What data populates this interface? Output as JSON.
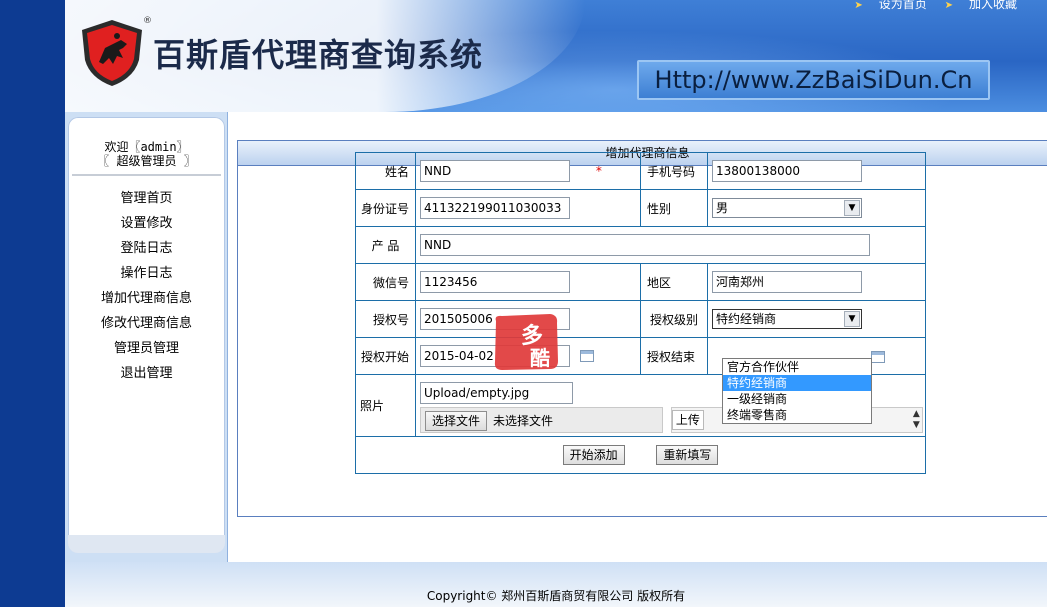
{
  "header": {
    "app_title": "百斯盾代理商查询系统",
    "reg_mark": "®",
    "url": "Http://www.ZzBaiSiDun.Cn",
    "links": [
      "设为首页",
      "加入收藏"
    ]
  },
  "sidebar": {
    "welcome_line1": "欢迎〖admin〗",
    "welcome_line2": "〖 超级管理员 〗",
    "items": [
      {
        "label": "管理首页"
      },
      {
        "label": "设置修改"
      },
      {
        "label": "登陆日志"
      },
      {
        "label": "操作日志"
      },
      {
        "label": "增加代理商信息"
      },
      {
        "label": "修改代理商信息"
      },
      {
        "label": "管理员管理"
      },
      {
        "label": "退出管理"
      }
    ]
  },
  "form": {
    "title": "增加代理商信息",
    "name_label": "姓名",
    "name_value": "NND",
    "required_mark": "*",
    "phone_label": "手机号码",
    "phone_value": "13800138000",
    "id_label": "身份证号",
    "id_value": "411322199011030033",
    "gender_label": "性别",
    "gender_value": "男",
    "product_label": "产 品",
    "product_value": "NND",
    "wechat_label": "微信号",
    "wechat_value": "1123456",
    "region_label": "地区",
    "region_value": "河南郑州",
    "auth_no_label": "授权号",
    "auth_no_value": "201505006",
    "auth_level_label": "授权级别",
    "auth_level_value": "特约经销商",
    "auth_level_options": [
      "官方合作伙伴",
      "特约经销商",
      "一级经销商",
      "终端零售商"
    ],
    "auth_level_highlighted": "特约经销商",
    "start_label": "授权开始",
    "start_value": "2015-04-02",
    "end_label": "授权结束",
    "photo_label": "照片",
    "photo_value": "Upload/empty.jpg",
    "choose_file_label": "选择文件",
    "no_file_text": "未选择文件",
    "upload_label": "上传",
    "submit_label": "开始添加",
    "reset_label": "重新填写"
  },
  "watermark": {
    "text": "多酷"
  },
  "footer": {
    "text": "Copyright© 郑州百斯盾商贸有限公司 版权所有"
  },
  "colors": {
    "left_rail": "#0d3b92",
    "header_blue": "#2a66c4",
    "table_border": "#1c6ea8",
    "highlight": "#3399ff",
    "required": "#dd0000"
  }
}
